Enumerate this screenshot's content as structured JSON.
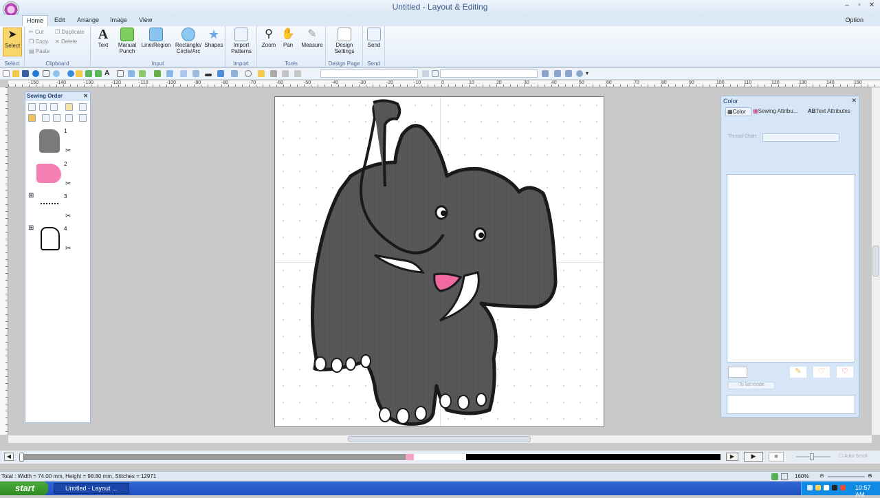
{
  "window": {
    "title": "Untitled - Layout & Editing",
    "minimize": "–",
    "maximize": "▫",
    "close": "✕"
  },
  "tabs": [
    {
      "label": "Home"
    },
    {
      "label": "Edit"
    },
    {
      "label": "Arrange"
    },
    {
      "label": "Image"
    },
    {
      "label": "View"
    }
  ],
  "option_label": "Option",
  "ribbon": {
    "select": {
      "label": "Select",
      "group": "Select"
    },
    "clipboard": {
      "cut": "Cut",
      "copy": "Copy",
      "paste": "Paste",
      "duplicate": "Duplicate",
      "delete": "Delete",
      "group": "Clipboard"
    },
    "text": "Text",
    "manual_punch": "Manual Punch",
    "line_region": "Line/Region",
    "rect_circle": "Rectangle/ Circle/Arc",
    "shapes": "Shapes",
    "input_group": "Input",
    "import_patterns": "Import Patterns",
    "import_group": "Import",
    "zoom": "Zoom",
    "pan": "Pan",
    "measure": "Measure",
    "tools_group": "Tools",
    "design_settings": "Design Settings",
    "design_page_group": "Design Page",
    "send": "Send",
    "send_group": "Send"
  },
  "ruler_top_labels": [
    "-150",
    "-140",
    "-130",
    "-120",
    "-110",
    "-100",
    "-90",
    "-80",
    "-70",
    "-60",
    "-50",
    "-40",
    "-30",
    "-20",
    "-10",
    "0",
    "10",
    "20",
    "30",
    "40",
    "50",
    "60",
    "70",
    "80",
    "90",
    "100",
    "110",
    "120",
    "130",
    "140",
    "150"
  ],
  "sewing_order": {
    "title": "Sewing Order",
    "items": [
      {
        "num": "1"
      },
      {
        "num": "2"
      },
      {
        "num": "3"
      },
      {
        "num": "4"
      }
    ]
  },
  "color_panel": {
    "title": "Color",
    "tabs": [
      {
        "label": "Color"
      },
      {
        "label": "Sewing Attribu..."
      },
      {
        "label": "Text Attributes"
      }
    ],
    "thread_chart_label": "Thread Chart",
    "to_list_mode": "To list mode"
  },
  "status": {
    "text": "Total : Width = 74.00 mm, Height = 98.80 mm, Stitches = 12971",
    "zoom": "160%",
    "auto_scroll": "Auto Scroll"
  },
  "taskbar": {
    "start": "start",
    "task": "Untitled - Layout ...",
    "clock": "10:57 AM"
  },
  "colors": {
    "accent": "#dbe7f6",
    "elephant_gray": "#5a5a5c",
    "tongue_pink": "#f06aa0"
  }
}
